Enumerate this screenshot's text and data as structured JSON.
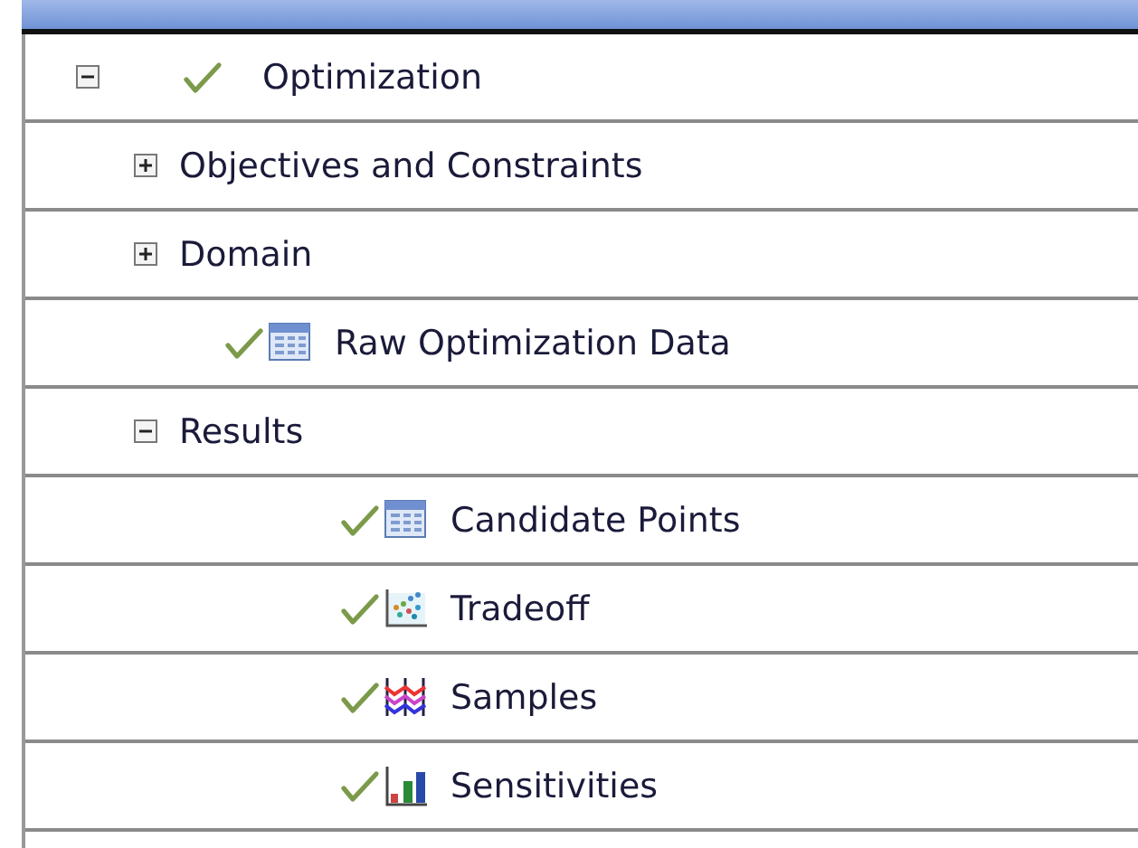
{
  "tree": [
    {
      "label": "Optimization",
      "expanded": true,
      "checked": true,
      "children": [
        {
          "label": "Objectives and Constraints",
          "expanded": false
        },
        {
          "label": "Domain",
          "expanded": false
        },
        {
          "label": "Raw Optimization Data",
          "checked": true,
          "kind": "table"
        },
        {
          "label": "Results",
          "expanded": true,
          "children": [
            {
              "label": "Candidate Points",
              "checked": true,
              "kind": "table"
            },
            {
              "label": "Tradeoff",
              "checked": true,
              "kind": "scatter"
            },
            {
              "label": "Samples",
              "checked": true,
              "kind": "lines"
            },
            {
              "label": "Sensitivities",
              "checked": true,
              "kind": "bars"
            }
          ]
        }
      ]
    }
  ]
}
